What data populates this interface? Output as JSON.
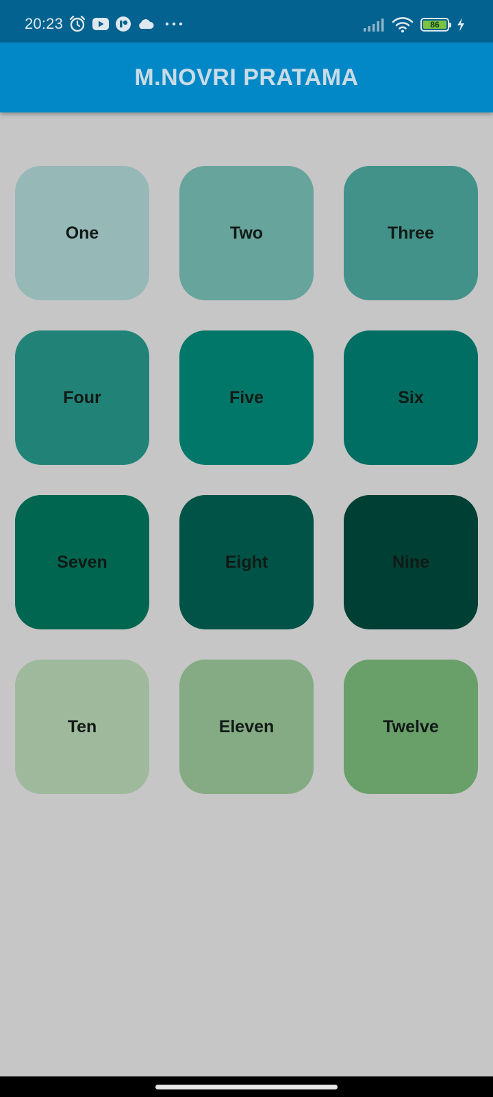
{
  "status_bar": {
    "time": "20:23",
    "battery_level": "86",
    "icons": [
      "alarm-icon",
      "youtube-icon",
      "app-notification-icon",
      "cloud-icon",
      "more-dots-icon",
      "signal-icon",
      "wifi-icon",
      "battery-icon",
      "charging-icon"
    ]
  },
  "app_bar": {
    "title": "M.NOVRI PRATAMA"
  },
  "tiles": [
    {
      "label": "One",
      "color": "#96b8b6"
    },
    {
      "label": "Two",
      "color": "#67a49b"
    },
    {
      "label": "Three",
      "color": "#43928a"
    },
    {
      "label": "Four",
      "color": "#218378"
    },
    {
      "label": "Five",
      "color": "#007769"
    },
    {
      "label": "Six",
      "color": "#006e62"
    },
    {
      "label": "Seven",
      "color": "#00664f"
    },
    {
      "label": "Eight",
      "color": "#005346"
    },
    {
      "label": "Nine",
      "color": "#003f33"
    },
    {
      "label": "Ten",
      "color": "#9fb99d"
    },
    {
      "label": "Eleven",
      "color": "#84ab83"
    },
    {
      "label": "Twelve",
      "color": "#699f69"
    }
  ],
  "colors": {
    "background": "#c6c6c6",
    "status_bar": "#03628f",
    "app_bar": "#0288c6",
    "battery_fill": "#7cc142"
  }
}
